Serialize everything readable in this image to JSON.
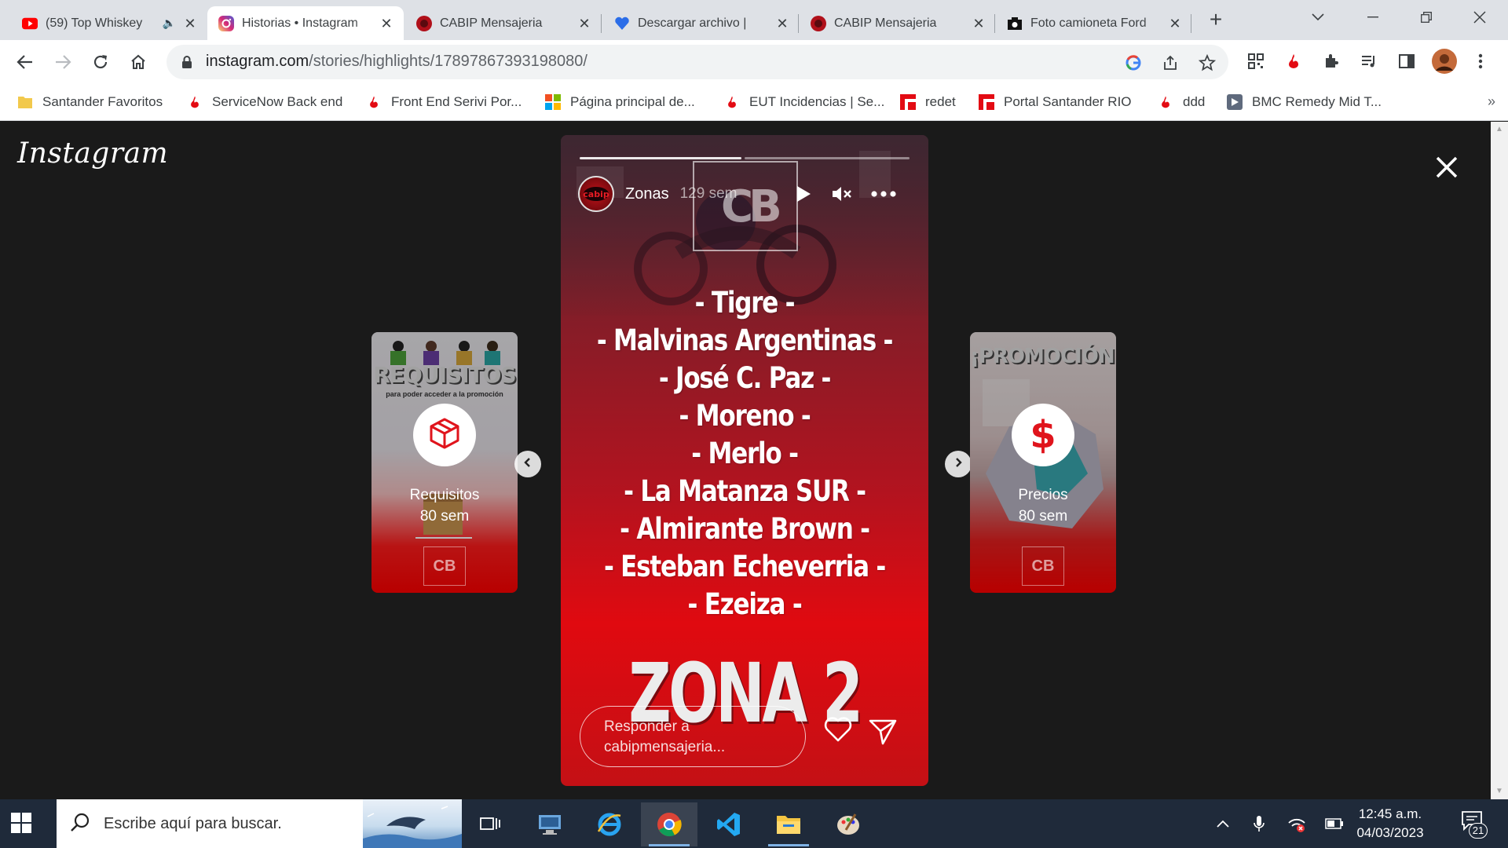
{
  "browser": {
    "tabs": [
      {
        "title": "(59) Top Whiskey",
        "icon": "youtube-icon"
      },
      {
        "title": "Historias • Instagram",
        "icon": "instagram-icon"
      },
      {
        "title": "CABIP Mensajeria",
        "icon": "cabip-icon"
      },
      {
        "title": "Descargar archivo | ",
        "icon": "heart-icon"
      },
      {
        "title": "CABIP Mensajeria",
        "icon": "cabip-icon"
      },
      {
        "title": "Foto camioneta Ford",
        "icon": "camera-icon"
      }
    ],
    "url_domain": "instagram.com",
    "url_path": "/stories/highlights/17897867393198080/",
    "bookmarks": [
      {
        "label": "Santander Favoritos",
        "icon": "folder-icon"
      },
      {
        "label": "ServiceNow Back end",
        "icon": "santander-icon"
      },
      {
        "label": "Front End Serivi Por...",
        "icon": "santander-icon"
      },
      {
        "label": "Página principal de...",
        "icon": "microsoft-icon"
      },
      {
        "label": "EUT Incidencias | Se...",
        "icon": "santander-icon"
      },
      {
        "label": "redet",
        "icon": "redet-icon"
      },
      {
        "label": "Portal Santander RIO",
        "icon": "redet-icon"
      },
      {
        "label": "ddd",
        "icon": "santander-icon"
      },
      {
        "label": "BMC Remedy Mid T...",
        "icon": "bmc-icon"
      }
    ],
    "bookmarks_more": "»"
  },
  "instagram": {
    "logo": "Instagram",
    "left_story": {
      "name": "Requisitos",
      "time": "80 sem",
      "header": "REQUISITOS",
      "subheader": "para poder acceder a la promoción"
    },
    "right_story": {
      "name": "Precios",
      "time": "80 sem",
      "header": "¡PROMOCIÓN!"
    },
    "main_story": {
      "username": "Zonas",
      "time": "129 sem",
      "logo_text": "CB",
      "zones": [
        "- Tigre -",
        "- Malvinas Argentinas -",
        "- José C. Paz -",
        "- Moreno -",
        "- Merlo -",
        "- La Matanza SUR -",
        "- Almirante Brown -",
        "- Esteban Echeverria -",
        "- Ezeiza -"
      ],
      "title": "ZONA 2",
      "reply_placeholder": "Responder a cabipmensajeria..."
    }
  },
  "taskbar": {
    "search_placeholder": "Escribe aquí para buscar.",
    "time": "12:45 a.m.",
    "date": "04/03/2023",
    "notifications": "21"
  },
  "colors": {
    "story_red": "#e00a10",
    "chrome_tabstrip": "#dee1e6",
    "taskbar": "#1f2a3a"
  }
}
